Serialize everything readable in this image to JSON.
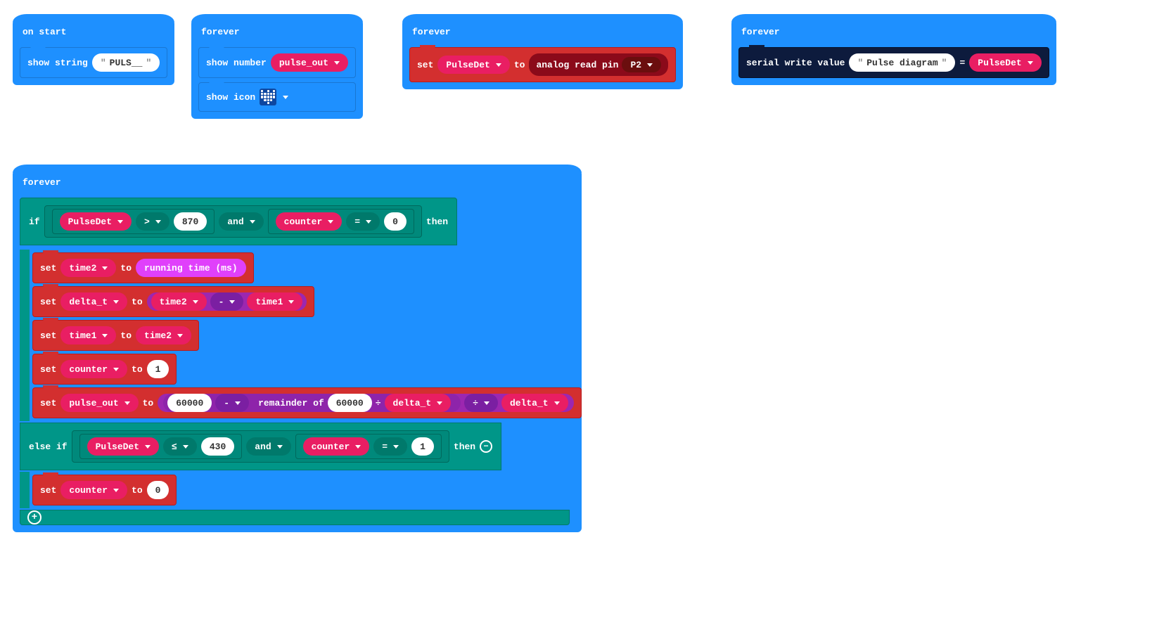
{
  "block1": {
    "hat": "on start",
    "show_string_label": "show string",
    "show_string_value": "PULS__"
  },
  "block2": {
    "hat": "forever",
    "show_number_label": "show number",
    "var_pulse_out": "pulse_out",
    "show_icon_label": "show icon"
  },
  "block3": {
    "hat": "forever",
    "set_label": "set",
    "var_pulsedet": "PulseDet",
    "to_label": "to",
    "analog_read_label": "analog read pin",
    "pin_value": "P2"
  },
  "block4": {
    "hat": "forever",
    "serial_write_label": "serial write value",
    "serial_name": "Pulse diagram",
    "equals": "=",
    "var_pulsedet": "PulseDet"
  },
  "block5": {
    "hat": "forever",
    "if_label": "if",
    "then_label": "then",
    "else_if_label": "else if",
    "var_pulsedet": "PulseDet",
    "op_gt": ">",
    "val_870": "870",
    "and_label": "and",
    "var_counter": "counter",
    "op_eq": "=",
    "val_0": "0",
    "set_label": "set",
    "to_label": "to",
    "var_time2": "time2",
    "running_time_label": "running time (ms)",
    "var_delta_t": "delta_t",
    "op_minus": "-",
    "var_time1": "time1",
    "val_1": "1",
    "var_pulse_out": "pulse_out",
    "val_60000": "60000",
    "remainder_label": "remainder of",
    "op_div": "÷",
    "op_lte": "≤",
    "val_430": "430"
  }
}
